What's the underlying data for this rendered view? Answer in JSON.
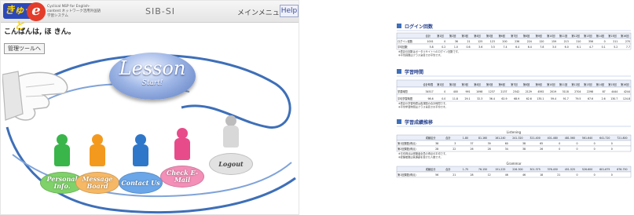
{
  "header": {
    "logo_text": "きゅっと",
    "logo_letter": "e",
    "tagline": "Cyclical NSP for English-content ネットワーク活用外国語学習システム",
    "system_name": "SIB-SI",
    "menu_label": "メインメニュー",
    "help_label": "Help"
  },
  "greeting": "こんばんは, ほ きん。",
  "tool_link": "管理ツールへ",
  "lesson": {
    "title": "Lesson",
    "subtitle": "Start!"
  },
  "nav": [
    {
      "label": "Personal Info.",
      "color": "#39b54a",
      "oval": "#7fd26a"
    },
    {
      "label": "Message Board",
      "color": "#f39a1e",
      "oval": "#f7b865"
    },
    {
      "label": "Contact Us",
      "color": "#2f77c9",
      "oval": "#6aa6e8"
    },
    {
      "label": "Check E-Mail",
      "color": "#e84b8a",
      "oval": "#f48fb8"
    },
    {
      "label": "Logout",
      "color": "#c9c9c9",
      "oval": "#e2e2e2"
    }
  ],
  "report": {
    "login": {
      "title": "ログイン回数",
      "headers": [
        "合計",
        "第1回",
        "第2回",
        "第3回",
        "第4回",
        "第5回",
        "第6回",
        "第7回",
        "第8回",
        "第9回",
        "第10回",
        "第11回",
        "第12回",
        "第13回",
        "第14回",
        "第15回",
        "第16回"
      ],
      "rows": [
        {
          "label": "ログイン回数",
          "values": [
            "1001",
            "0",
            "36",
            "21",
            "125",
            "123",
            "200",
            "236",
            "224",
            "120",
            "159",
            "213",
            "210",
            "356",
            "0",
            "211",
            "270"
          ]
        },
        {
          "label": "平均回数",
          "values": [
            "5.8",
            "0.2",
            "1.0",
            "0.6",
            "3.6",
            "3.5",
            "7.4",
            "6.4",
            "6.4",
            "7.8",
            "3.0",
            "6.0",
            "6.1",
            "4.7",
            "0.1",
            "5.2",
            "7.7"
          ]
        }
      ],
      "notes": [
        "※表記の回数はポータルサイトへのログイン回数です。",
        "※平均回数はクラス全員での平均です。"
      ]
    },
    "study": {
      "title": "学習時間",
      "headers": [
        "合計時間",
        "第1回",
        "第2回",
        "第3回",
        "第4回",
        "第5回",
        "第6回",
        "第7回",
        "第8回",
        "第9回",
        "第10回",
        "第11回",
        "第12回",
        "第13回",
        "第14回",
        "第15回",
        "第16回"
      ],
      "rows": [
        {
          "label": "学習時間",
          "values": [
            "34517",
            "0",
            "400",
            "991",
            "1098",
            "1237",
            "2137",
            "2342",
            "2129",
            "4592",
            "2019",
            "3118",
            "2704",
            "2298",
            "87",
            "4444",
            "4244"
          ]
        },
        {
          "label": "平均学習時間",
          "values": [
            "98.6",
            "0.0",
            "11.8",
            "29.1",
            "32.3",
            "36.4",
            "62.9",
            "68.9",
            "62.6",
            "135.1",
            "59.4",
            "91.7",
            "79.5",
            "67.6",
            "2.6",
            "130.7",
            "124.8"
          ]
        }
      ],
      "notes": [
        "※表記の学習時間は各課題の合計時間です。",
        "※平均学習時間はクラス全員での平均です。"
      ]
    },
    "scores": {
      "title": "学習成績推移",
      "sections": [
        {
          "name": "Listening",
          "headers": [
            "成績区分",
            "合計",
            "1-80",
            "81-160",
            "161-240",
            "241-320",
            "321-400",
            "401-480",
            "481-560",
            "561-640",
            "641-720",
            "721-800"
          ],
          "rows": [
            {
              "label": "第1回課題(得点)",
              "values": [
                "38",
                "3",
                "37",
                "39",
                "60",
                "38",
                "65",
                "0",
                "0",
                "0",
                "0"
              ]
            },
            {
              "label": "第2回課題(得点)",
              "values": [
                "28",
                "22",
                "26",
                "28",
                "34",
                "38",
                "26",
                "0",
                "0",
                "0",
                "0"
              ]
            }
          ],
          "notes": [
            "※平均得点は受験者全員の得点の平均です。",
            "※受験者数は各課題を受けた人数です。"
          ]
        },
        {
          "name": "Grammar",
          "headers": [
            "成績区分",
            "合計",
            "1-75",
            "76-150",
            "151-225",
            "226-300",
            "301-375",
            "376-450",
            "451-525",
            "526-600",
            "601-675",
            "676-750"
          ],
          "rows": [
            {
              "label": "第1回課題(得点)",
              "values": [
                "56",
                "21",
                "28",
                "12",
                "46",
                "46",
                "18",
                "21",
                "0",
                "0",
                "0"
              ]
            }
          ]
        }
      ]
    }
  }
}
